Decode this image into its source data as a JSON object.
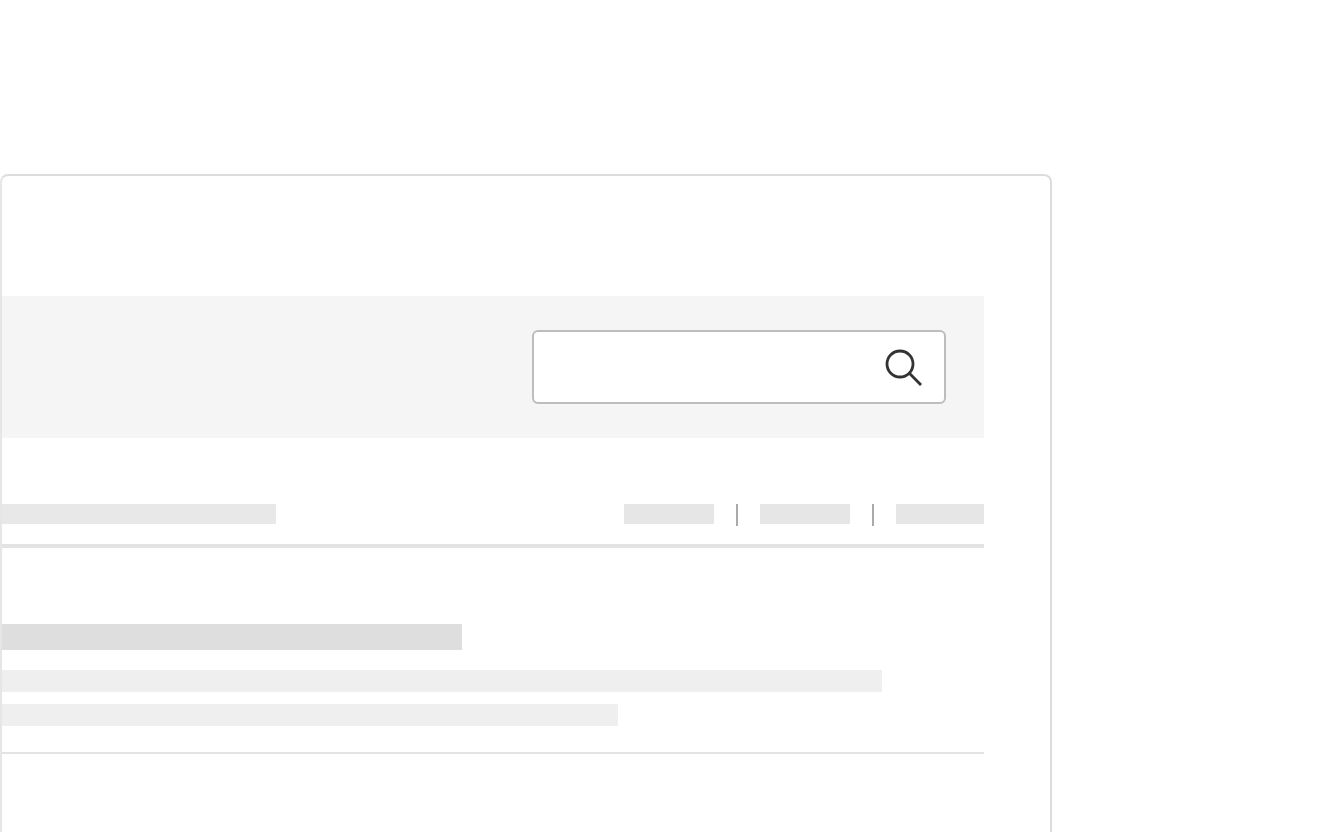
{
  "search": {
    "kind": "search"
  },
  "header_links": [
    {
      "kind": "skeleton"
    },
    {
      "kind": "skeleton"
    },
    {
      "kind": "skeleton"
    }
  ],
  "heading": {
    "kind": "skeleton"
  },
  "item": {
    "title": {
      "kind": "skeleton"
    },
    "lines": [
      {
        "kind": "skeleton"
      },
      {
        "kind": "skeleton"
      }
    ]
  }
}
